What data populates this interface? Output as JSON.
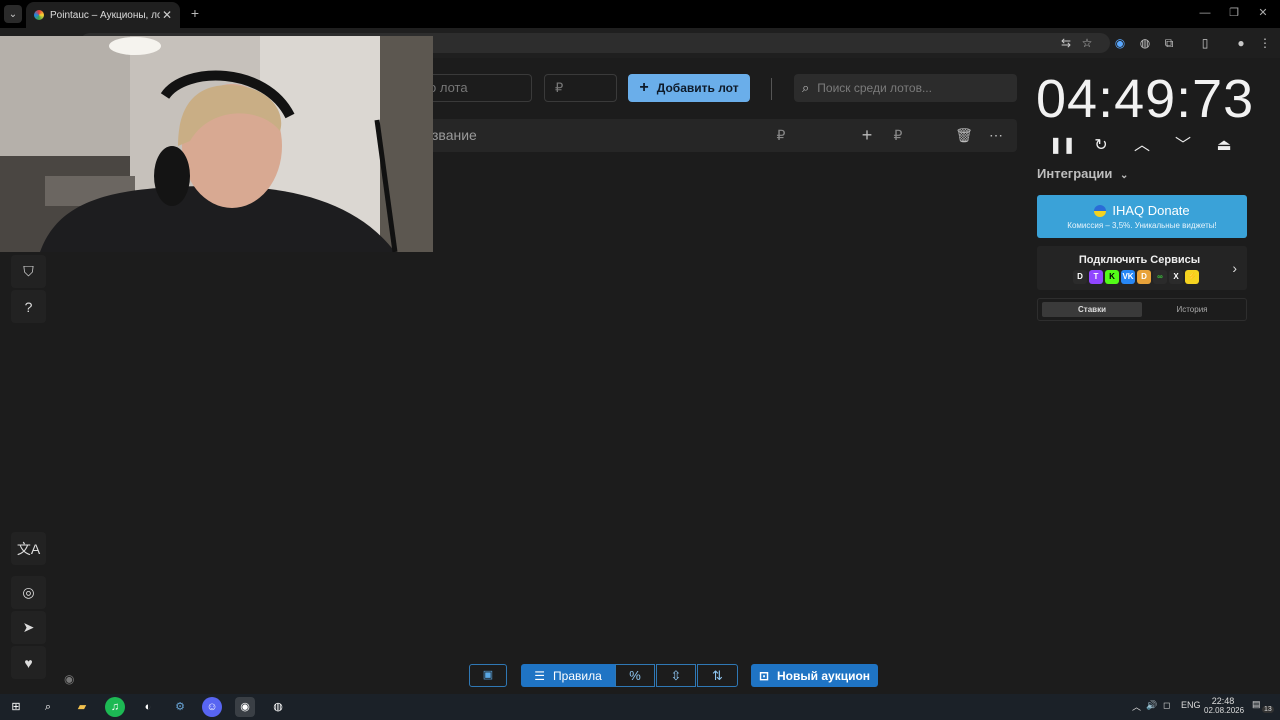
{
  "browser": {
    "tab_title": "Pointauc – Аукционы, лотереи",
    "tab_close": "✕",
    "new_tab": "+"
  },
  "auction": {
    "lot_name_placeholder": "о лота",
    "price_placeholder": "₽",
    "add_lot_label": "Добавить лот",
    "search_placeholder": "Поиск среди лотов...",
    "lot_row": {
      "name": "звание",
      "currency": "₽",
      "add_currency": "₽"
    }
  },
  "timer": {
    "value": "04:49:73",
    "integrations_label": "Интеграции",
    "donate": {
      "title": "IHAQ Donate",
      "subtitle": "Комиссия – 3,5%. Уникальные виджеты!"
    },
    "services_title": "Подключить Сервисы",
    "tabs": [
      "Ставки",
      "История"
    ]
  },
  "bottom_bar": {
    "rules_label": "Правила",
    "percent_label": "%",
    "new_auction_label": "Новый аукцион"
  },
  "taskbar": {
    "language": "ENG",
    "time": "22:48",
    "date": "02.08.2026",
    "notifications": "13"
  },
  "colors": {
    "accent": "#1f74c4",
    "add_lot": "#6aaeea",
    "donate": "#3aa2d8",
    "background": "#1c1c1c"
  }
}
